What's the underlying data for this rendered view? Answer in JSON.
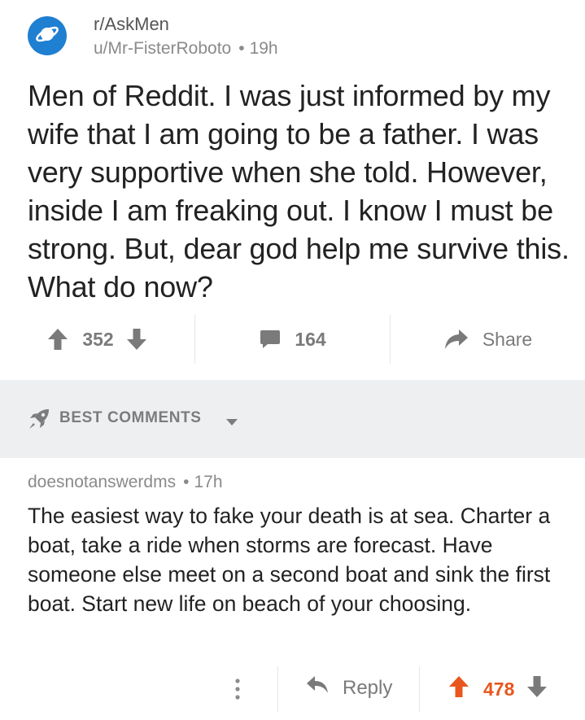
{
  "post": {
    "subreddit": "r/AskMen",
    "author": "u/Mr-FisterRoboto",
    "separator": "•",
    "age": "19h",
    "title": "Men of Reddit. I was just informed by my wife that I am going to be a father. I was very supportive when she told. However, inside I am freaking out. I know I must be strong. But, dear god help me survive this. What do now?",
    "score": "352",
    "comment_count": "164",
    "share_label": "Share"
  },
  "sort": {
    "label": "BEST COMMENTS"
  },
  "comment": {
    "author": "doesnotanswerdms",
    "separator": "•",
    "age": "17h",
    "body": "The easiest way to fake your death is at sea. Charter a boat, take a ride when storms are forecast. Have someone else meet on a second boat and sink the first boat. Start new life on beach of your choosing.",
    "reply_label": "Reply",
    "score": "478"
  },
  "colors": {
    "subreddit_icon_bg": "#1f7fd1",
    "upvoted": "#e8561e",
    "muted_text": "#7a7a7a",
    "band_bg": "#edeff1"
  },
  "icons": {
    "subreddit": "planet-icon",
    "upvote": "upvote-arrow-icon",
    "downvote": "downvote-arrow-icon",
    "comments": "comment-bubble-icon",
    "share": "share-arrow-icon",
    "sort": "rocket-icon",
    "caret": "caret-down-icon",
    "more": "more-vertical-icon",
    "reply": "reply-arrow-icon"
  }
}
